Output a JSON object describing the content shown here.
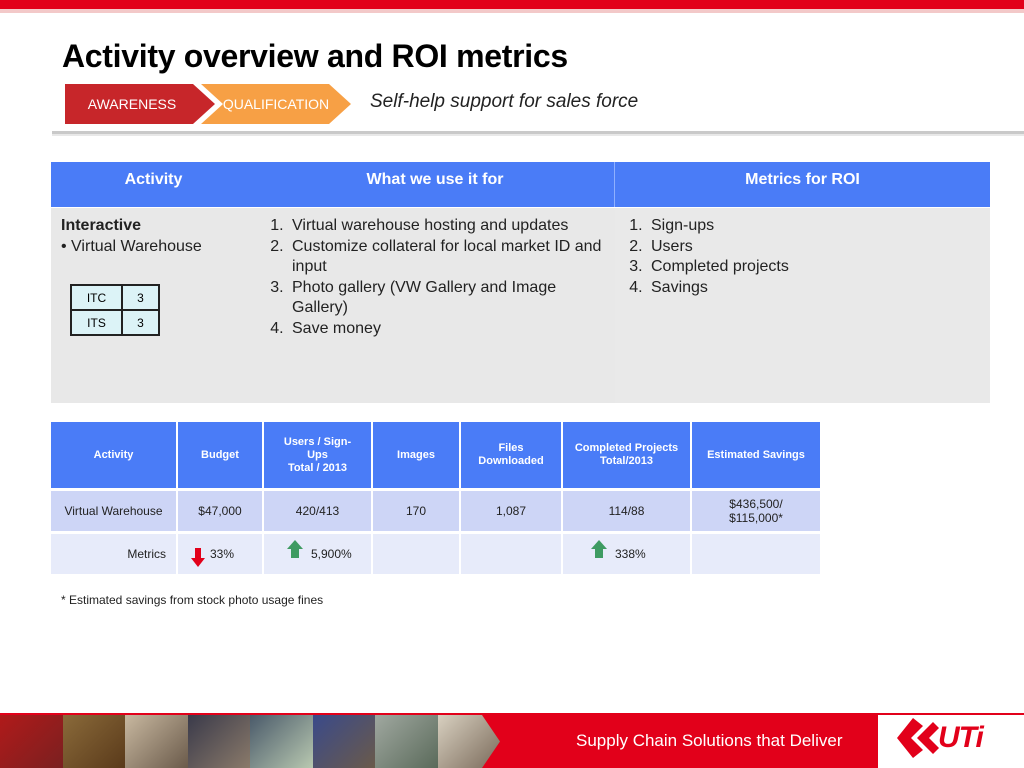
{
  "slide": {
    "title": "Activity overview and ROI metrics",
    "stages": [
      "AWARENESS",
      "QUALIFICATION"
    ],
    "subtitle": "Self-help support for sales force"
  },
  "overview_table": {
    "headers": [
      "Activity",
      "What we use it for",
      "Metrics for ROI"
    ],
    "activity": {
      "heading": "Interactive",
      "item": "• Virtual Warehouse"
    },
    "uses": [
      "Virtual warehouse hosting and updates",
      "Customize collateral for local market ID and input",
      "Photo gallery (VW Gallery and Image Gallery)",
      "Save money"
    ],
    "metrics": [
      "Sign-ups",
      "Users",
      "Completed projects",
      "Savings"
    ],
    "mini_table": [
      {
        "label": "ITC",
        "value": "3"
      },
      {
        "label": "ITS",
        "value": "3"
      }
    ]
  },
  "roi_table": {
    "headers": [
      "Activity",
      "Budget",
      "Users / Sign-Ups\nTotal / 2013",
      "Images",
      "Files Downloaded",
      "Completed Projects Total/2013",
      "Estimated Savings"
    ],
    "header_lines": {
      "users": [
        "Users / Sign-",
        "Ups",
        "Total / 2013"
      ],
      "files": [
        "Files",
        "Downloaded"
      ],
      "projects": [
        "Completed Projects",
        "Total/2013"
      ]
    },
    "row1": {
      "activity": "Virtual Warehouse",
      "budget": "$47,000",
      "users": "420/413",
      "images": "170",
      "files": "1,087",
      "projects": "114/88",
      "savings_line1": "$436,500/",
      "savings_line2": "$115,000*"
    },
    "row2": {
      "label": "Metrics",
      "budget": "33%",
      "users": "5,900%",
      "projects": "338%",
      "budget_trend": "down-arrow-icon",
      "users_trend": "up-arrow-icon",
      "projects_trend": "up-arrow-icon"
    }
  },
  "footnote": "* Estimated savings from stock photo usage fines",
  "footer": {
    "tagline": "Supply Chain Solutions that Deliver",
    "logo": "UTi"
  },
  "colors": {
    "brand_red": "#e2001a",
    "header_blue": "#4a7cf7",
    "stage_orange": "#f7a045",
    "up_green": "#3e9b62"
  }
}
